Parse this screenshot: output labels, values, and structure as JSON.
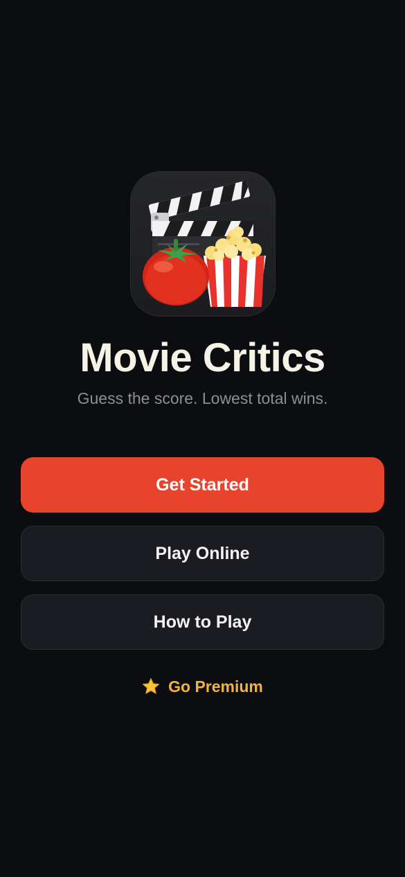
{
  "app": {
    "title": "Movie Critics",
    "subtitle": "Guess the score. Lowest total wins.",
    "icon": "clapperboard-tomato-popcorn-icon"
  },
  "actions": {
    "get_started": "Get Started",
    "play_online": "Play Online",
    "how_to_play": "How to Play",
    "go_premium": "Go Premium",
    "premium_icon": "star-icon"
  },
  "colors": {
    "background": "#0c0d10",
    "primary": "#e8432c",
    "secondary_button": "#1a1c21",
    "premium_accent": "#f2b53a",
    "title_text": "#f6f2e6",
    "subtitle_text": "#8e8f96"
  }
}
